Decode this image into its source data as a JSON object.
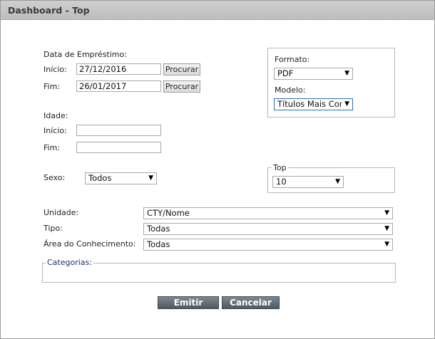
{
  "window": {
    "title": "Dashboard - Top"
  },
  "emprestimo": {
    "label": "Data de Empréstimo:",
    "inicio_label": "Início:",
    "inicio_value": "27/12/2016",
    "fim_label": "Fim:",
    "fim_value": "26/01/2017",
    "procurar_label": "Procurar"
  },
  "idade": {
    "label": "Idade:",
    "inicio_label": "Início:",
    "inicio_value": "",
    "fim_label": "Fim:",
    "fim_value": ""
  },
  "sexo": {
    "label": "Sexo:",
    "value": "Todos"
  },
  "formato": {
    "label": "Formato:",
    "value": "PDF"
  },
  "modelo": {
    "label": "Modelo:",
    "value": "Títulos Mais Consultados"
  },
  "top": {
    "label": "Top",
    "value": "10"
  },
  "unidade": {
    "label": "Unidade:",
    "value": "CTY/Nome"
  },
  "tipo": {
    "label": "Tipo:",
    "value": "Todas"
  },
  "area": {
    "label": "Área do Conhecimento:",
    "value": "Todas"
  },
  "categorias": {
    "label": "Categorias:",
    "accent": "#1f2f6b"
  },
  "actions": {
    "emitir_label": "Emitir",
    "cancelar_label": "Cancelar"
  },
  "icons": {
    "dropdown": "triangle-down-icon"
  }
}
